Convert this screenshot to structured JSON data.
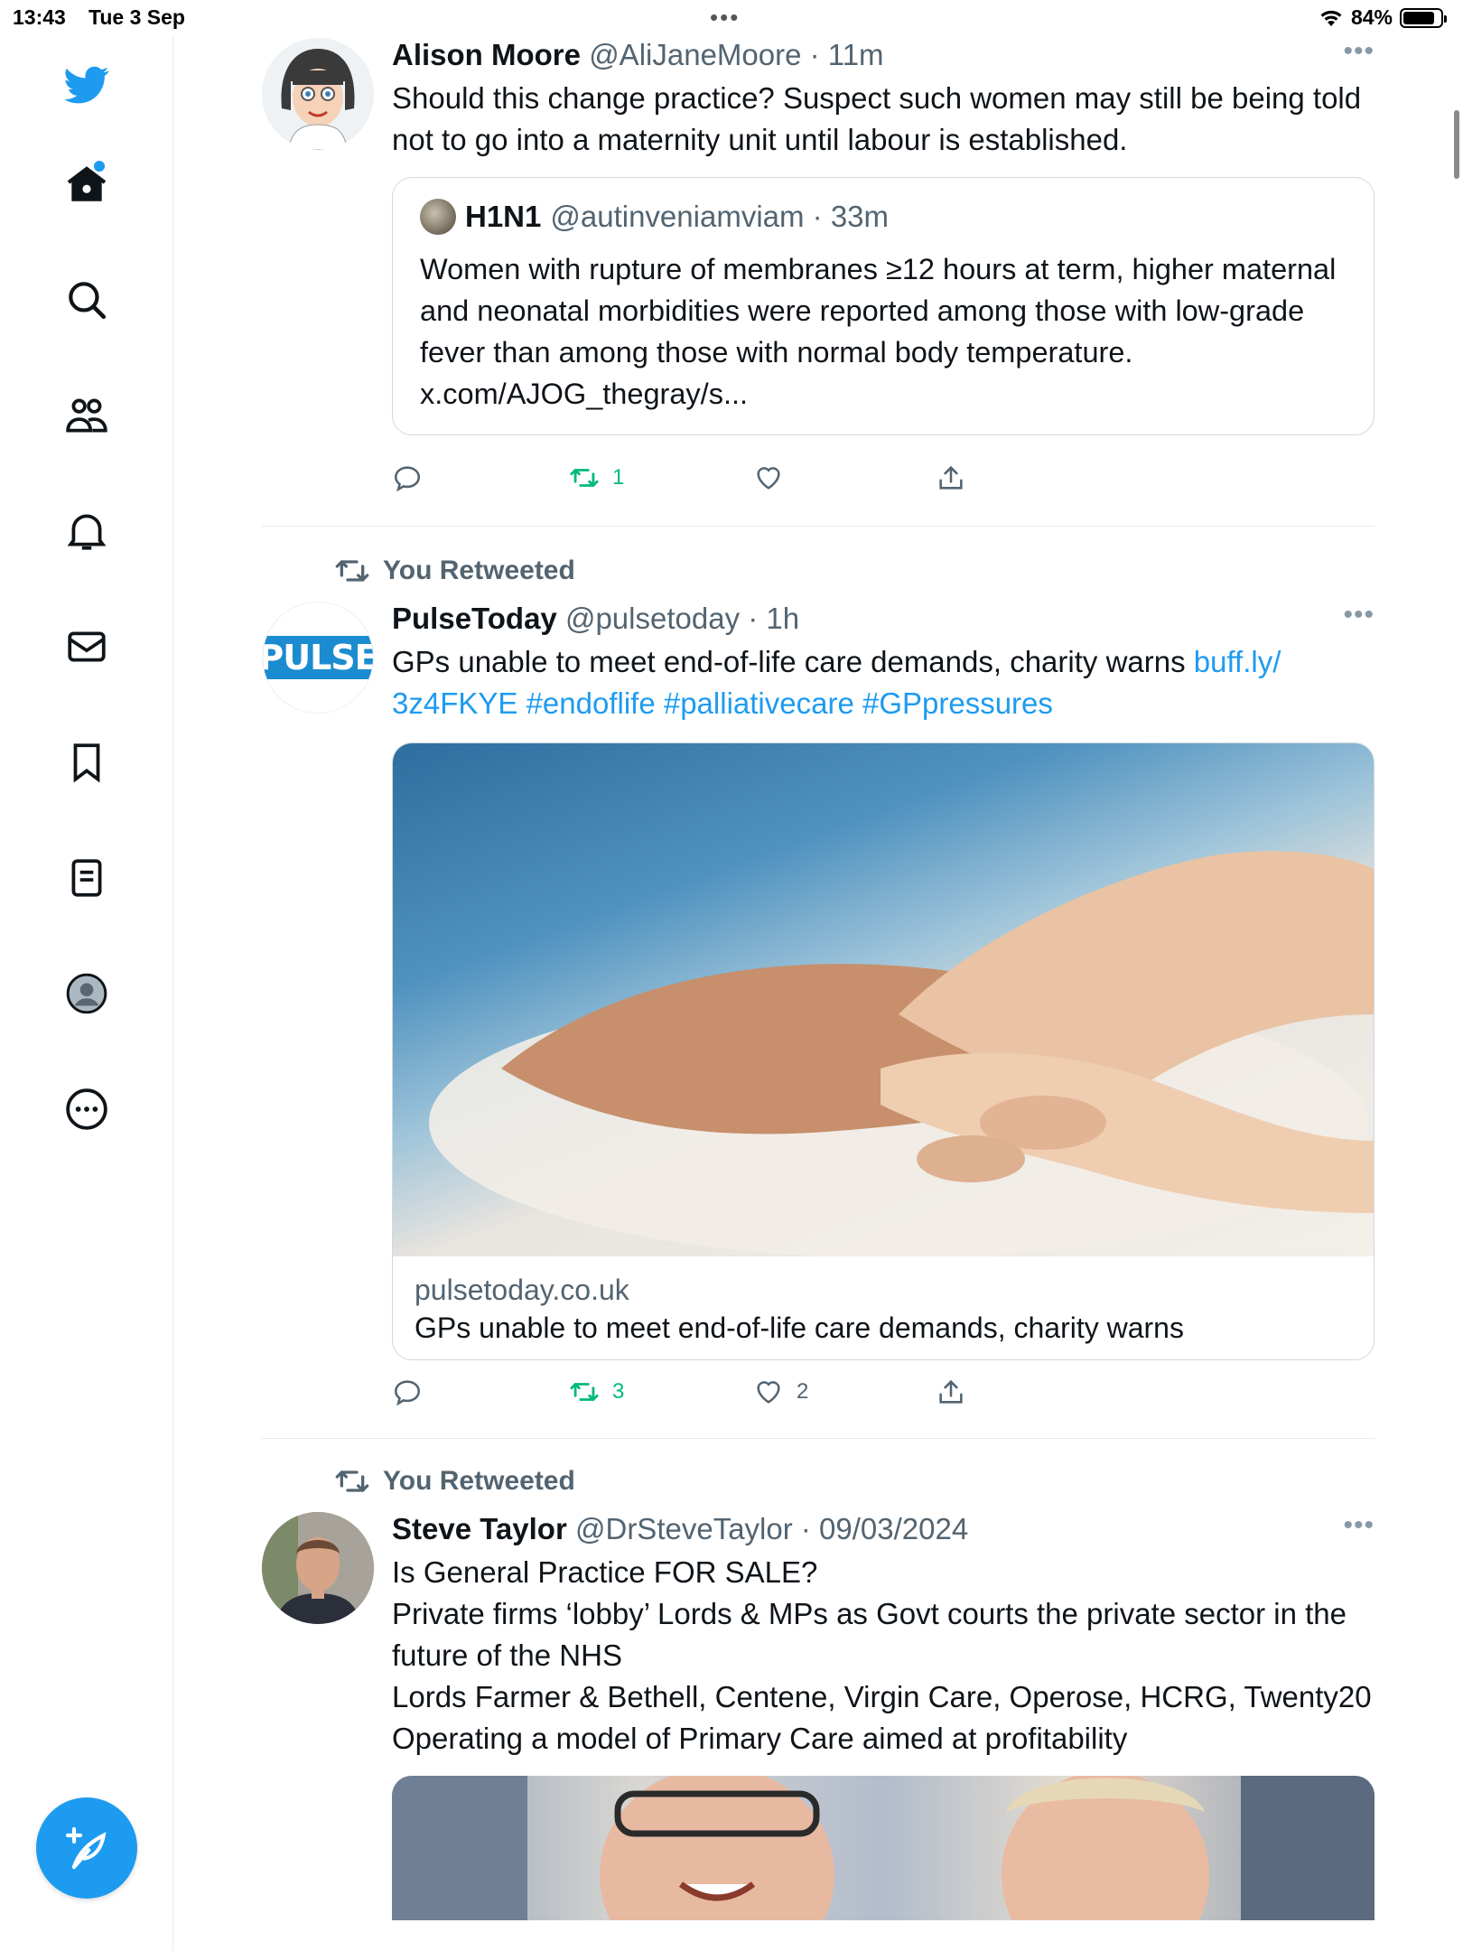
{
  "status": {
    "time": "13:43",
    "date": "Tue 3 Sep",
    "battery": "84%",
    "battery_level": 0.84
  },
  "sidebar": {
    "items": [
      {
        "icon": "twitter-bird-icon"
      },
      {
        "icon": "home-icon",
        "has_notification": true
      },
      {
        "icon": "search-icon"
      },
      {
        "icon": "communities-icon"
      },
      {
        "icon": "bell-icon"
      },
      {
        "icon": "mail-icon"
      },
      {
        "icon": "bookmark-icon"
      },
      {
        "icon": "lists-icon"
      },
      {
        "icon": "profile-avatar-icon"
      },
      {
        "icon": "more-icon"
      }
    ],
    "compose_icon": "compose-feather-icon"
  },
  "colors": {
    "accent": "#1d9bf0",
    "retweet": "#00ba7c",
    "muted": "#536471"
  },
  "tweets": [
    {
      "name": "Alison Moore",
      "meta": "@AliJaneMoore · 11m",
      "text": "Should this change practice? Suspect such women may still be being told not to go into a maternity unit until labour is established.",
      "quote": {
        "name": "H1N1",
        "meta": "@autinveniamviam · 33m",
        "text": "Women with rupture of membranes ≥12 hours at term, higher maternal and neonatal morbidities were reported among those with low-grade fever than among those with normal body temperature. x.com/AJOG_thegray/s..."
      },
      "actions": {
        "reply": "",
        "retweet": "1",
        "like": "",
        "share": ""
      }
    },
    {
      "retweet_label": "You Retweeted",
      "name": "PulseToday",
      "meta": "@pulsetoday · 1h",
      "avatar_text": "PULSE",
      "text_plain": "GPs unable to meet end-of-life care demands, charity warns ",
      "text_link": "buff.ly/ 3z4FKYE #endoflife #palliativecare #GPpressures",
      "card": {
        "domain": "pulsetoday.co.uk",
        "title": "GPs unable to meet end-of-life care demands, charity warns"
      },
      "actions": {
        "reply": "",
        "retweet": "3",
        "like": "2",
        "share": ""
      }
    },
    {
      "retweet_label": "You Retweeted",
      "name": "Steve Taylor",
      "meta": "@DrSteveTaylor · 09/03/2024",
      "lines": [
        "Is General Practice FOR SALE?",
        "Private firms ‘lobby’ Lords & MPs as Govt courts the private sector in the future of the NHS",
        "Lords Farmer & Bethell, Centene, Virgin Care, Operose, HCRG, Twenty20",
        "Operating a model of Primary Care aimed at profitability"
      ]
    }
  ]
}
